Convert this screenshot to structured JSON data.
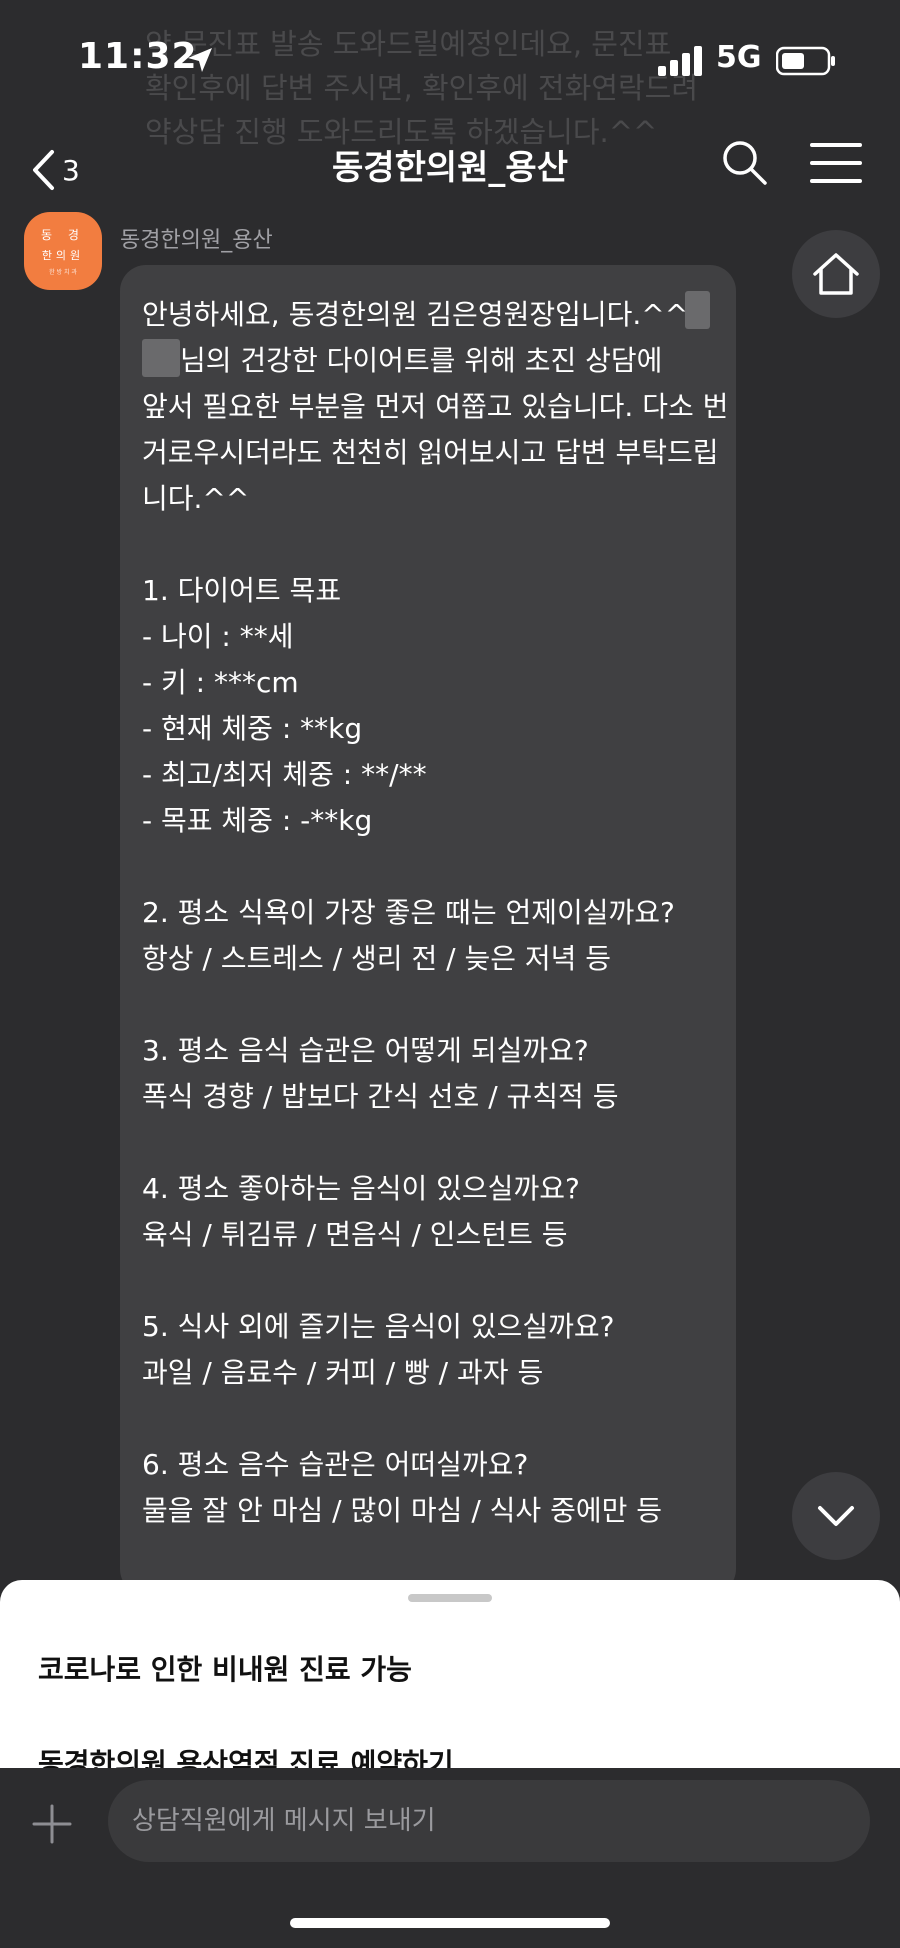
{
  "status": {
    "time": "11:32",
    "network": "5G",
    "icons": [
      "location-arrow-icon",
      "signal-bars-icon",
      "battery-icon"
    ]
  },
  "background_text": [
    "약 문진표 발송 도와드릴예정인데요, 문진표",
    "확인후에 답변 주시면, 확인후에 전화연락드려",
    "약상담 진행 도와드리도록 하겠습니다.^^"
  ],
  "header": {
    "back_count": "3",
    "title": "동경한의원_용산",
    "icons": [
      "chevron-left-icon",
      "search-icon",
      "hamburger-menu-icon"
    ]
  },
  "sender": {
    "name": "동경한의원_용산",
    "avatar_line1": "동 경",
    "avatar_line2": "한의원",
    "avatar_line3": "한 방 치 과"
  },
  "message": {
    "lines": [
      "안녕하세요, 동경한의원 김은영원장입니다.^^",
      "님의 건강한 다이어트를 위해 초진 상담에",
      "앞서 필요한 부분을 먼저 여쭙고 있습니다. 다소 번",
      "거로우시더라도 천천히 읽어보시고 답변 부탁드립",
      "니다.^^",
      "",
      "1. 다이어트 목표",
      "- 나이 : **세",
      "- 키 : ***cm",
      "- 현재 체중 : **kg",
      "- 최고/최저 체중 : **/**",
      "- 목표 체중 : -**kg",
      "",
      "2. 평소 식욕이 가장 좋은 때는 언제이실까요?",
      "항상 / 스트레스 / 생리 전 / 늦은 저녁 등",
      "",
      "3. 평소 음식 습관은 어떻게 되실까요?",
      "폭식 경향 / 밥보다 간식 선호 / 규칙적 등",
      "",
      "4. 평소 좋아하는 음식이 있으실까요?",
      "육식 / 튀김류 / 면음식 / 인스턴트 등",
      "",
      "5. 식사 외에 즐기는 음식이 있으실까요?",
      "과일 / 음료수 / 커피 / 빵 / 과자 등",
      "",
      "6. 평소 음수 습관은 어떠실까요?",
      "물을 잘 안 마심 / 많이 마심 / 식사 중에만 등"
    ]
  },
  "floating": {
    "home_icon": "home-icon",
    "down_icon": "chevron-down-icon"
  },
  "sheet": {
    "items": [
      "코로나로 인한 비내원 진료 가능",
      "동경한의원 용산역점 진료 예약하기"
    ]
  },
  "composer": {
    "placeholder": "상담직원에게 메시지 보내기",
    "plus_icon": "plus-icon"
  }
}
